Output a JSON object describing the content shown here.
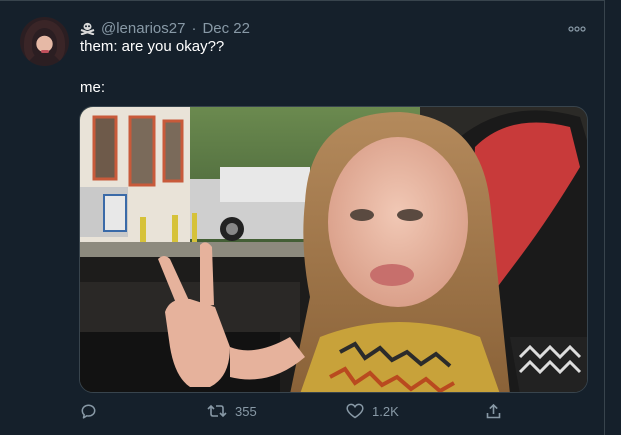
{
  "tweet": {
    "handle": "@lenarios27",
    "separator": "·",
    "date": "Dec 22",
    "line1": "them: are you okay??",
    "line2": "me:"
  },
  "icons": {
    "author_badge": "skull-crossbones-icon",
    "more": "more-dots-icon",
    "reply": "reply-bubble-icon",
    "retweet": "retweet-arrows-icon",
    "like": "heart-icon",
    "share": "share-upload-icon"
  },
  "actions": {
    "retweets": "355",
    "likes": "1.2K"
  },
  "colors": {
    "background": "#15202b",
    "muted": "#8899a6",
    "border": "#38444d"
  }
}
